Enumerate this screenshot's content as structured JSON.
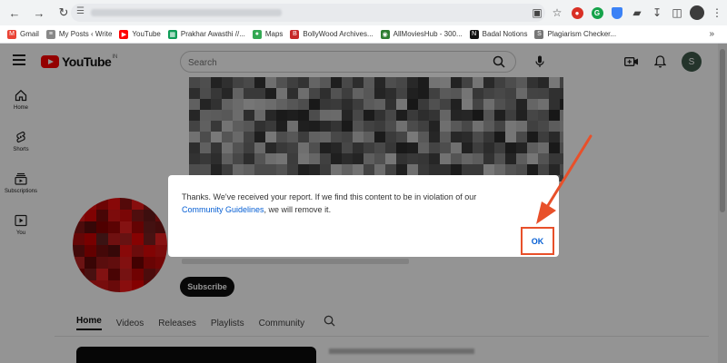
{
  "bookmarks": [
    {
      "label": "Gmail",
      "color": "#ea4335",
      "icon": "mail-icon"
    },
    {
      "label": "My Posts ‹ Write",
      "color": "#888888",
      "icon": "feed-icon"
    },
    {
      "label": "YouTube",
      "color": "#ff0000",
      "icon": "youtube-icon"
    },
    {
      "label": "Prakhar Awasthi //...",
      "color": "#0f9d58",
      "icon": "grid-icon"
    },
    {
      "label": "Maps",
      "color": "#34a853",
      "icon": "maps-pin-icon"
    },
    {
      "label": "BollyWood Archives...",
      "color": "#c62828",
      "icon": "bw-icon"
    },
    {
      "label": "AllMoviesHub - 300...",
      "color": "#2e7d32",
      "icon": "globe-icon"
    },
    {
      "label": "Badal Notions",
      "color": "#111111",
      "icon": "notion-icon"
    },
    {
      "label": "Plagiarism Checker...",
      "color": "#777777",
      "icon": "sst-icon"
    }
  ],
  "youtube": {
    "wordmark": "YouTube",
    "country": "IN",
    "search_placeholder": "Search",
    "avatar_letter": "S"
  },
  "sidebar": {
    "items": [
      {
        "label": "Home"
      },
      {
        "label": "Shorts"
      },
      {
        "label": "Subscriptions"
      },
      {
        "label": "You"
      }
    ]
  },
  "channel": {
    "subscribe_label": "Subscribe",
    "tabs": [
      {
        "label": "Home",
        "active": true
      },
      {
        "label": "Videos",
        "active": false
      },
      {
        "label": "Releases",
        "active": false
      },
      {
        "label": "Playlists",
        "active": false
      },
      {
        "label": "Community",
        "active": false
      }
    ]
  },
  "dialog": {
    "message_before": "Thanks. We've received your report. If we find this content to be in violation of our ",
    "link_text": "Community Guidelines",
    "message_after": ", we will remove it.",
    "ok_label": "OK"
  },
  "colors": {
    "annotation": "#e8502a",
    "link": "#065fd4",
    "yt_red": "#ff0000"
  }
}
